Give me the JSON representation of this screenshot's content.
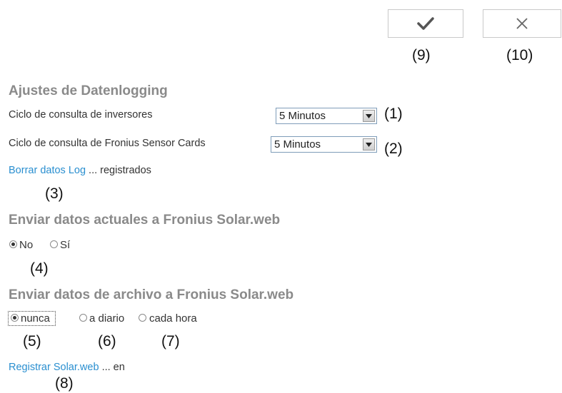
{
  "toolbar": {
    "confirm_icon": "check-icon",
    "cancel_icon": "close-icon",
    "confirm_callout": "(9)",
    "cancel_callout": "(10)"
  },
  "datalogging": {
    "title": "Ajustes de Datenlogging",
    "inverter_label": "Ciclo de consulta de inversores",
    "inverter_value": "5 Minutos",
    "inverter_callout": "(1)",
    "sensor_label": "Ciclo de consulta de Fronius Sensor Cards",
    "sensor_value": "5 Minutos",
    "sensor_callout": "(2)",
    "delete_link": "Borrar datos Log",
    "delete_suffix": "... registrados",
    "delete_callout": "(3)"
  },
  "current_data": {
    "title": "Enviar datos actuales a Fronius Solar.web",
    "option_no": "No",
    "option_yes": "Sí",
    "selected": "No",
    "callout": "(4)"
  },
  "archive_data": {
    "title": "Enviar datos de archivo a Fronius Solar.web",
    "option_never": "nunca",
    "option_daily": "a diario",
    "option_hourly": "cada hora",
    "selected": "nunca",
    "callout_never": "(5)",
    "callout_daily": "(6)",
    "callout_hourly": "(7)"
  },
  "register": {
    "link": "Registrar Solar.web",
    "suffix": "... en",
    "callout": "(8)"
  },
  "colors": {
    "heading": "#8a8a8a",
    "link": "#2a8fd0",
    "text": "#333333"
  }
}
